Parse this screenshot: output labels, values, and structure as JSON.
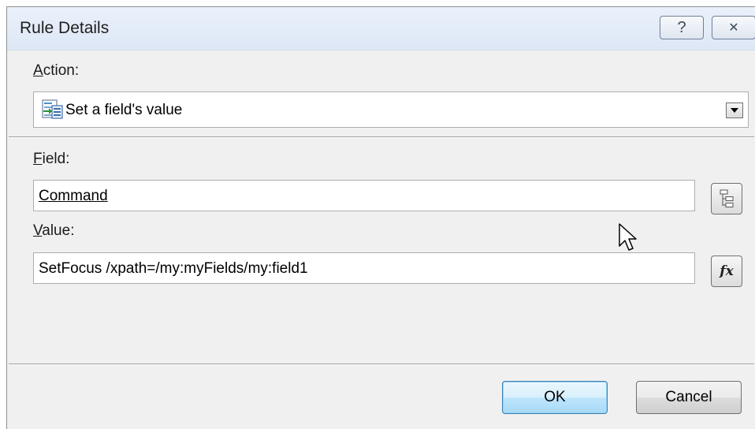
{
  "window": {
    "title": "Rule Details",
    "help_glyph": "?",
    "close_glyph": "✕"
  },
  "action": {
    "label_accel": "A",
    "label_rest": "ction:",
    "selected_value": "Set a field's value",
    "icon": "set-field-value-icon"
  },
  "field": {
    "label_accel": "F",
    "label_rest": "ield:",
    "value": "Command",
    "button_icon": "tree-view-icon"
  },
  "value": {
    "label_accel": "V",
    "label_rest": "alue:",
    "value": "SetFocus /xpath=/my:myFields/my:field1",
    "button_glyph": "fx"
  },
  "buttons": {
    "ok_label": "OK",
    "cancel_label": "Cancel"
  }
}
